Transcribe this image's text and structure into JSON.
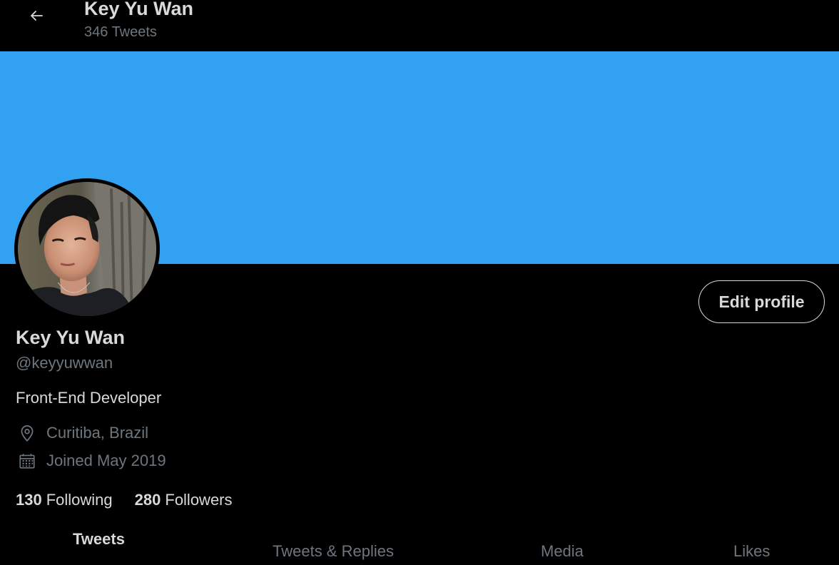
{
  "header": {
    "title": "Key Yu Wan",
    "tweet_count": "346 Tweets"
  },
  "banner": {
    "color": "#33a1f2"
  },
  "profile": {
    "name": "Key Yu Wan",
    "handle": "@keyyuwwan",
    "bio": "Front-End Developer",
    "location": "Curitiba, Brazil",
    "joined": "Joined May 2019",
    "edit_button": "Edit profile"
  },
  "stats": {
    "following_count": "130",
    "following_label": "Following",
    "followers_count": "280",
    "followers_label": "Followers"
  },
  "tabs": [
    {
      "label": "Tweets",
      "active": true
    },
    {
      "label": "Tweets & Replies",
      "active": false
    },
    {
      "label": "Media",
      "active": false
    },
    {
      "label": "Likes",
      "active": false
    }
  ],
  "icons": {
    "back": "arrow-left-icon",
    "location": "location-pin-icon",
    "calendar": "calendar-icon"
  },
  "colors": {
    "background": "#000000",
    "text": "#d9d9d9",
    "muted": "#6e767d",
    "accent": "#33a1f2"
  }
}
